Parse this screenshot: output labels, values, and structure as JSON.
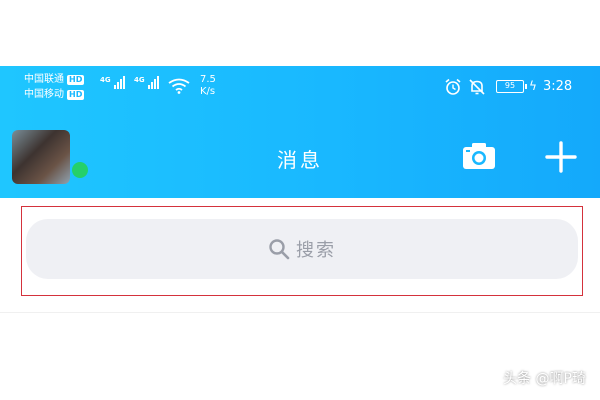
{
  "status_bar": {
    "carrier_1": "中国联通",
    "carrier_2": "中国移动",
    "hd_badge": "HD",
    "network_1": "4G",
    "network_2": "4G",
    "speed_value": "7.5",
    "speed_unit": "K/s",
    "battery_level": "95",
    "time": "3:28"
  },
  "header": {
    "title": "消息",
    "camera_icon": "camera-icon",
    "add_icon": "plus-icon"
  },
  "search": {
    "placeholder": "搜索",
    "icon": "search-icon"
  },
  "watermark": "头条 @啊P琦",
  "colors": {
    "header_gradient_start": "#1fc6ff",
    "header_gradient_end": "#14a9fb",
    "search_bg": "#eff0f4",
    "highlight_outline": "#d4323c",
    "online_dot": "#25d06b"
  }
}
